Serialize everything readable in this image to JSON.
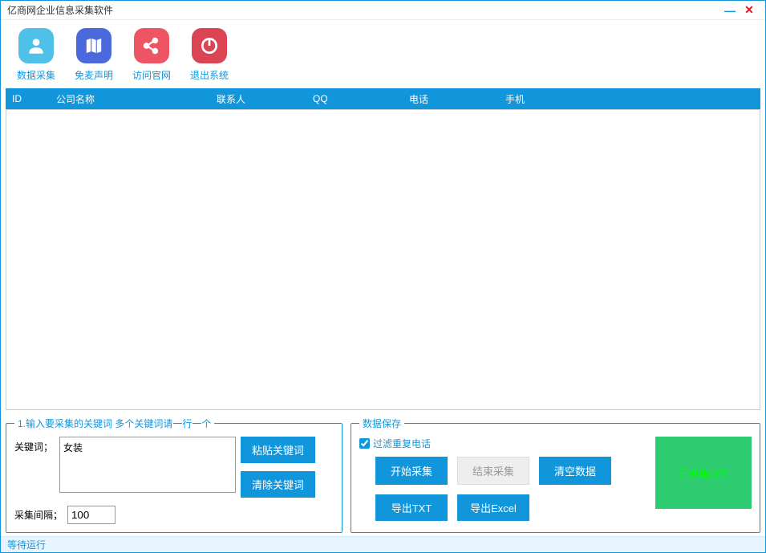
{
  "window": {
    "title": "亿商网企业信息采集软件"
  },
  "toolbar": [
    {
      "id": "collect",
      "label": "数据采集"
    },
    {
      "id": "disclaimer",
      "label": "免麦声明"
    },
    {
      "id": "website",
      "label": "访问官网"
    },
    {
      "id": "exit",
      "label": "退出系统"
    }
  ],
  "table": {
    "headers": {
      "id": "ID",
      "company": "公司名称",
      "contact": "联系人",
      "qq": "QQ",
      "phone": "电话",
      "mobile": "手机"
    },
    "rows": []
  },
  "keyword_panel": {
    "legend": "1.输入要采集的关键词 多个关键词请一行一个",
    "label": "关键词；",
    "value": "女装",
    "paste_btn": "粘贴关键词",
    "clear_btn": "清除关键词",
    "interval_label": "采集间隔；",
    "interval_value": "100"
  },
  "save_panel": {
    "legend": "数据保存",
    "filter_dup": "过滤重复电话",
    "filter_checked": true,
    "start_btn": "开始采集",
    "stop_btn": "结束采集",
    "clear_btn": "清空数据",
    "export_txt": "导出TXT",
    "export_excel": "导出Excel",
    "status": "已采集:0条"
  },
  "statusbar": "等待运行"
}
